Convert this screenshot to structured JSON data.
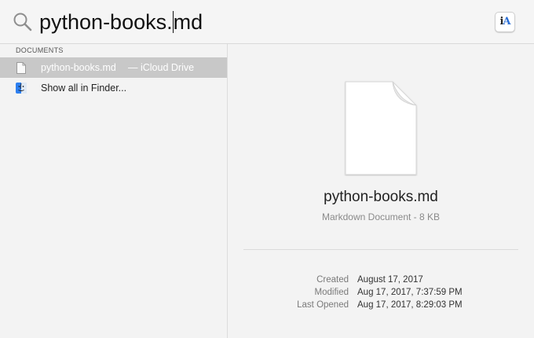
{
  "search": {
    "value_before_caret": "python-books.",
    "value_after_caret": "md"
  },
  "app_icon": {
    "prefix": "i",
    "accent": "A"
  },
  "results": {
    "section_header": "DOCUMENTS",
    "items": [
      {
        "label": "python-books.md",
        "sublabel": "— iCloud Drive",
        "icon": "document-icon",
        "selected": true
      },
      {
        "label": "Show all in Finder...",
        "icon": "finder-icon",
        "selected": false
      }
    ]
  },
  "preview": {
    "title": "python-books.md",
    "subtitle": "Markdown Document - 8 KB",
    "metadata": [
      {
        "label": "Created",
        "value": "August 17, 2017"
      },
      {
        "label": "Modified",
        "value": "Aug 17, 2017, 7:37:59 PM"
      },
      {
        "label": "Last Opened",
        "value": "Aug 17, 2017, 8:29:03 PM"
      }
    ]
  },
  "colors": {
    "selection": "#c8c8c8",
    "background": "#f3f3f3",
    "finder_blue": "#2d7ff0"
  }
}
